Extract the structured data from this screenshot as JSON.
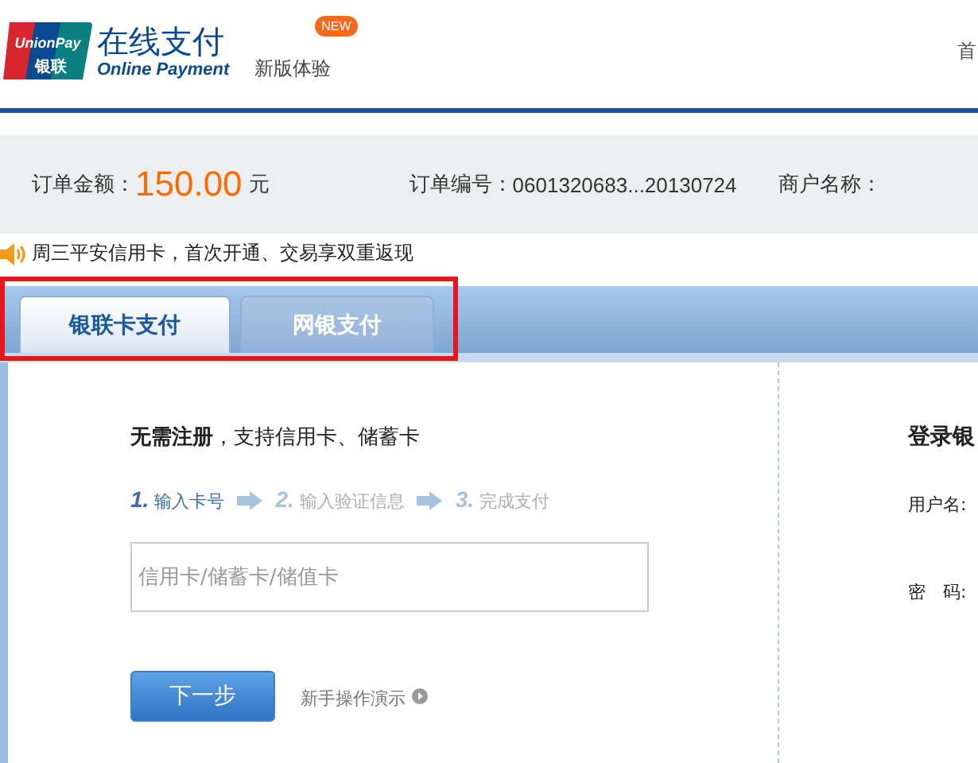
{
  "header": {
    "logo_top": "UnionPay",
    "logo_cn": "银联",
    "title": "在线支付",
    "subtitle": "Online Payment",
    "new_link": "新版体验",
    "new_badge": "NEW",
    "nav_link": "首"
  },
  "order": {
    "amount_label": "订单金额：",
    "amount": "150.00",
    "currency": "元",
    "number_label": "订单编号：",
    "number": "0601320683...20130724",
    "merchant_label": "商户名称："
  },
  "notice": "周三平安信用卡，首次开通、交易享双重返现",
  "tabs": [
    {
      "label": "银联卡支付",
      "selected": true
    },
    {
      "label": "网银支付",
      "selected": false
    }
  ],
  "card_pay": {
    "intro": "**无需注册**，支持信用卡、储蓄卡",
    "steps": [
      {
        "number": "1.",
        "label": "输入卡号",
        "selected": true
      },
      {
        "number": "2.",
        "label": "输入验证信息",
        "selected": false
      },
      {
        "number": "3.",
        "label": "完成支付",
        "selected": false
      }
    ],
    "card_field": {
      "placeholder": "信用卡/储蓄卡/储值卡"
    },
    "next_button": "下一步",
    "demo_link": "新手操作演示"
  },
  "bank_login": {
    "title": "登录银",
    "username_label": "用户名:",
    "password_label": "密　码:"
  }
}
